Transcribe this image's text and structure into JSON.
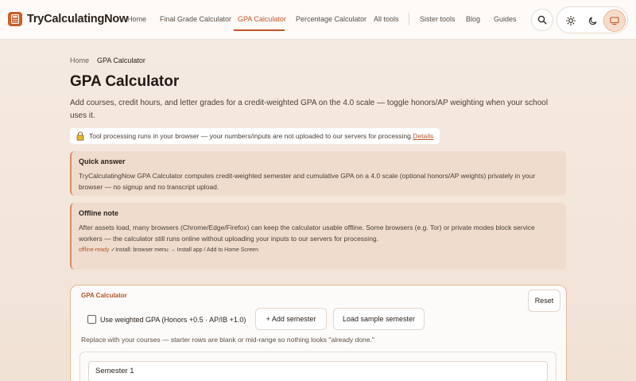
{
  "header": {
    "logo_text": "TryCalculatingNow",
    "nav": [
      "Home",
      "Final Grade Calculator",
      "GPA Calculator",
      "Percentage Calculator",
      "All tools",
      "Sister tools",
      "Blog",
      "Guides"
    ],
    "active_nav": "GPA Calculator",
    "icons": [
      "search-icon",
      "sun-icon",
      "moon-icon",
      "monitor-icon"
    ]
  },
  "breadcrumb": {
    "home": "Home",
    "current": "GPA Calculator"
  },
  "page": {
    "title": "GPA Calculator",
    "lede": "Add courses, credit hours, and letter grades for a credit-weighted GPA on the 4.0 scale — toggle honors/AP weighting when your school uses it."
  },
  "privacy": {
    "text": "Tool processing runs in your browser — your numbers/inputs are not uploaded to our servers for processing.",
    "link": "Details"
  },
  "quick_answer": {
    "title": "Quick answer",
    "body": "TryCalculatingNow GPA Calculator computes credit-weighted semester and cumulative GPA on a 4.0 scale (optional honors/AP weights) privately in your browser — no signup and no transcript upload."
  },
  "offline": {
    "title": "Offline note",
    "body": "After assets load, many browsers (Chrome/Edge/Firefox) can keep the calculator usable offline. Some browsers (e.g. Tor) or private modes block service workers — the calculator still runs online without uploading your inputs to our servers for processing.",
    "status": "offline-ready",
    "install": " ✓Install: browser menu → Install app / Add to Home Screen"
  },
  "calculator": {
    "title": "GPA Calculator",
    "reset": "Reset",
    "weighted_label": "Use weighted GPA (Honors +0.5 · AP/IB +1.0)",
    "add_semester": "+ Add semester",
    "load_sample": "Load sample semester",
    "hint": "Replace with your courses — starter rows are blank or mid-range so nothing looks \"already done.\"",
    "semester_name": "Semester 1"
  },
  "colors": {
    "accent": "#c0562a",
    "background": "#f5ebe3",
    "callout": "#efdccd"
  }
}
